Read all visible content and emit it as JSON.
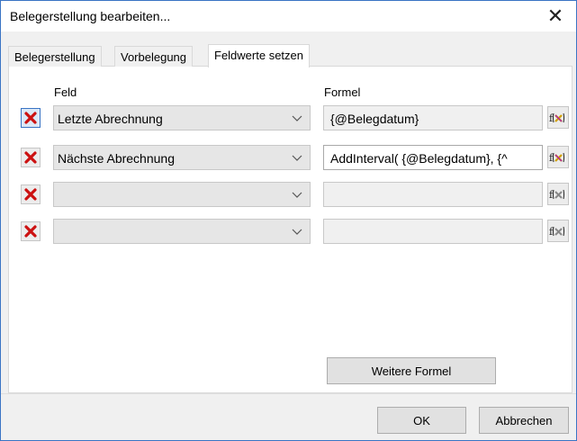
{
  "dialog": {
    "title": "Belegerstellung bearbeiten...",
    "close_glyph": "✕"
  },
  "tabs": [
    {
      "label": "Belegerstellung",
      "active": false
    },
    {
      "label": "Vorbelegung",
      "active": false
    },
    {
      "label": "Feldwerte setzen",
      "active": true
    }
  ],
  "columns": {
    "field": "Feld",
    "formula": "Formel"
  },
  "rows": [
    {
      "field": "Letzte Abrechnung",
      "formula": "{@Belegdatum}"
    },
    {
      "field": "Nächste Abrechnung",
      "formula": "AddInterval( {@Belegdatum}, {^"
    },
    {
      "field": "",
      "formula": ""
    },
    {
      "field": "",
      "formula": ""
    }
  ],
  "buttons": {
    "more_formula": "Weitere Formel",
    "ok": "OK",
    "cancel": "Abbrechen"
  },
  "icons": {
    "delete": "delete-x-icon",
    "formula": "function-fx-icon",
    "dropdown": "chevron-down-icon"
  },
  "colors": {
    "delete_red": "#cc1111",
    "focus_blue": "#3a74c4"
  }
}
